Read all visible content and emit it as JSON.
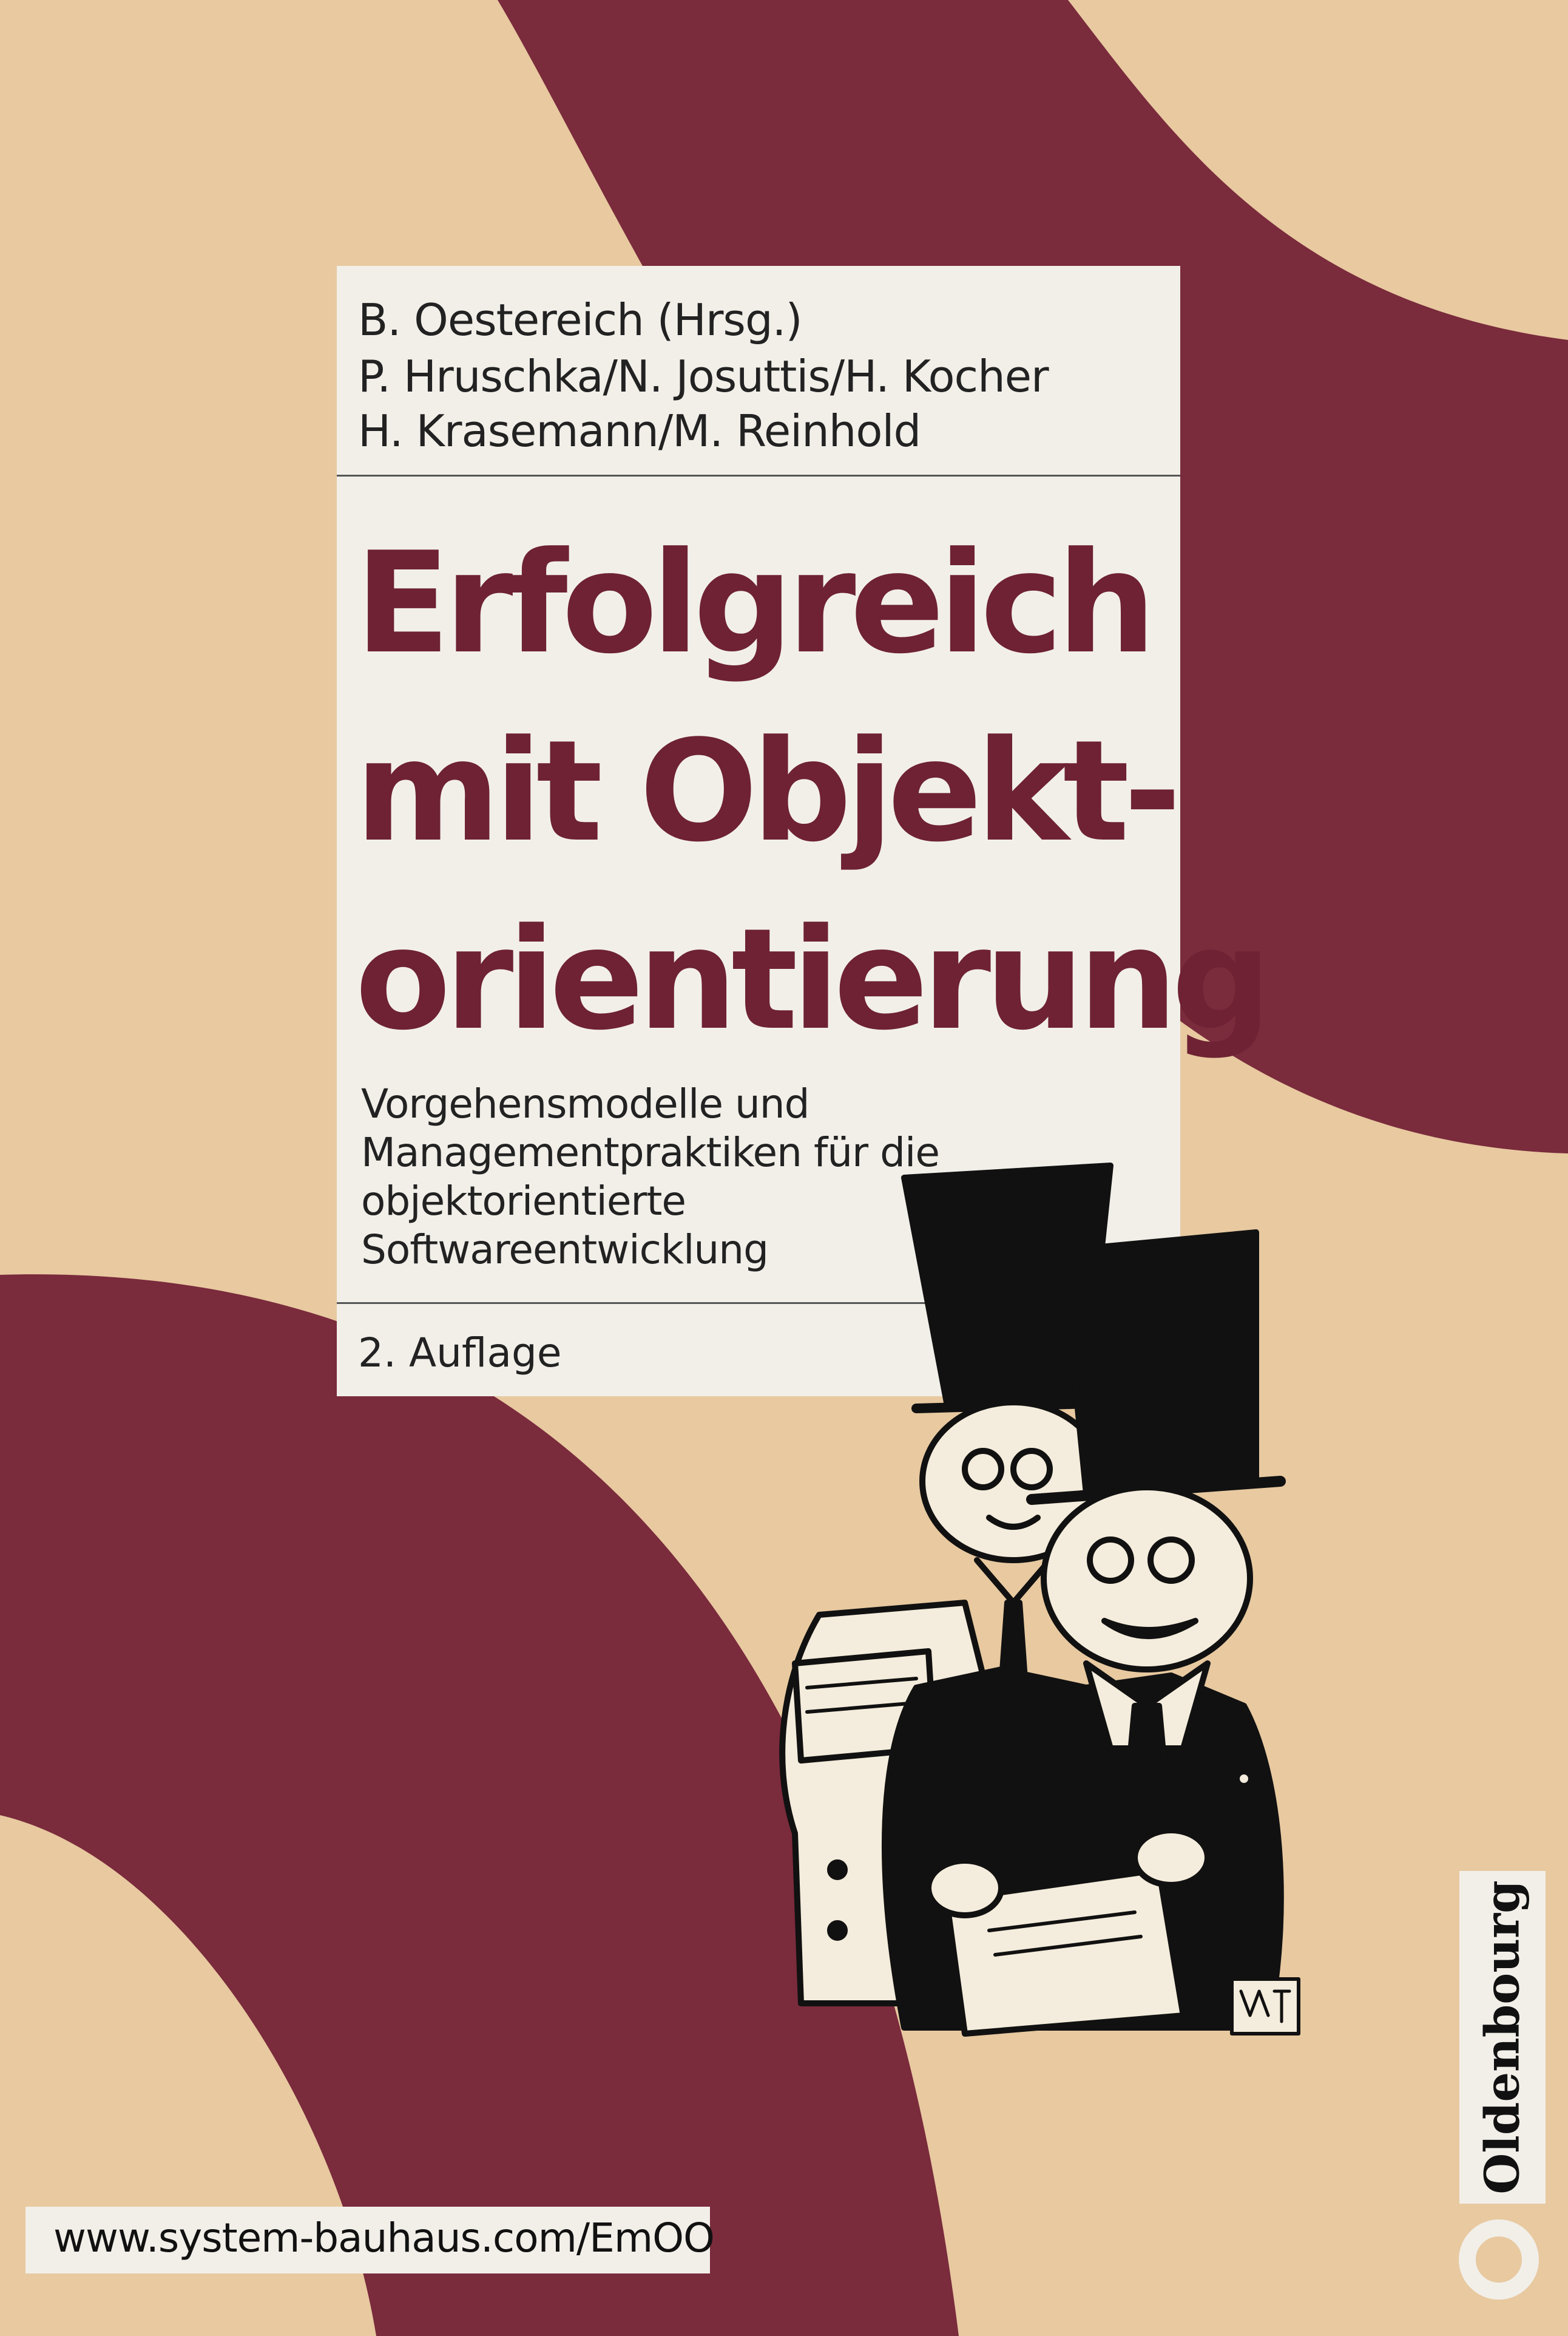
{
  "cover": {
    "authors": [
      "B. Oestereich (Hrsg.)",
      "P. Hruschka/N. Josuttis/H. Kocher",
      "H. Krasemann/M. Reinhold"
    ],
    "title_lines": [
      "Erfolgreich",
      "mit Objekt-",
      "orientierung"
    ],
    "subtitle_lines": [
      "Vorgehensmodelle und",
      "Managementpraktiken für die",
      "objektorientierte",
      "Softwareentwicklung"
    ],
    "edition": "2. Auflage",
    "url": "www.system-bauhaus.com/EmOO",
    "publisher": "Oldenbourg"
  },
  "colors": {
    "background_beige": "#e8c9a0",
    "maroon": "#7a2b3c",
    "title_maroon": "#6e2233",
    "panel_white": "#f2efe9"
  },
  "icons": {
    "illustration": "two-men-top-hats-cartoon",
    "publisher_logo": "oldenbourg-ring-logo"
  }
}
